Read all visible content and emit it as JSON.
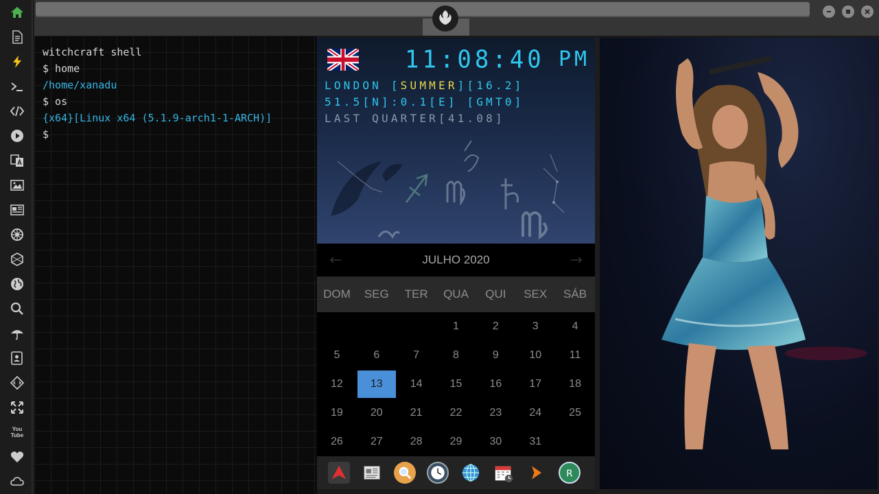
{
  "sidebar": {
    "icons": [
      "home-icon",
      "document-icon",
      "lightning-icon",
      "terminal-icon",
      "code-icon",
      "play-icon",
      "translate-icon",
      "image-icon",
      "news-icon",
      "settings-wheel-icon",
      "hexagon-icon",
      "globe-icon",
      "search-icon",
      "umbrella-icon",
      "contacts-icon",
      "diamond-code-icon",
      "expand-icon",
      "youtube-icon",
      "heart-icon",
      "cloud-icon"
    ],
    "youtube_label": "You Tube"
  },
  "terminal": {
    "lines": [
      {
        "text": "witchcraft shell",
        "color": "white"
      },
      {
        "text": "$ home",
        "color": "white"
      },
      {
        "text": "/home/xanadu",
        "color": "blue"
      },
      {
        "text": "$ os",
        "color": "white"
      },
      {
        "text": "{x64}[Linux x64 (5.1.9-arch1-1-ARCH)]",
        "color": "blue"
      },
      {
        "text": "$",
        "color": "white"
      }
    ]
  },
  "clock": {
    "time": "11:08:40",
    "ampm": "PM",
    "city": "LONDON",
    "season": "SUMMER",
    "temperature": "[16.2]",
    "coords": "51.5[N]:0.1[E] [GMT0]",
    "moon": "LAST QUARTER[41.08]",
    "accent_color": "#2fc7ee",
    "season_color": "#e9d74c"
  },
  "calendar": {
    "month_label": "JULHO 2020",
    "prev_label": "←",
    "next_label": "→",
    "weekdays": [
      "DOM",
      "SEG",
      "TER",
      "QUA",
      "QUI",
      "SEX",
      "SÁB"
    ],
    "first_weekday_index": 3,
    "days_in_month": 31,
    "today": 13,
    "today_color": "#4a90d9"
  },
  "dock": {
    "apps": [
      "arch-icon",
      "newspaper-icon",
      "search-magnifier-icon",
      "clock-app-icon",
      "browser-globe-icon",
      "calendar-app-icon",
      "arrow-app-icon",
      "yandex-icon"
    ],
    "active_app": "calendar-app-icon"
  }
}
